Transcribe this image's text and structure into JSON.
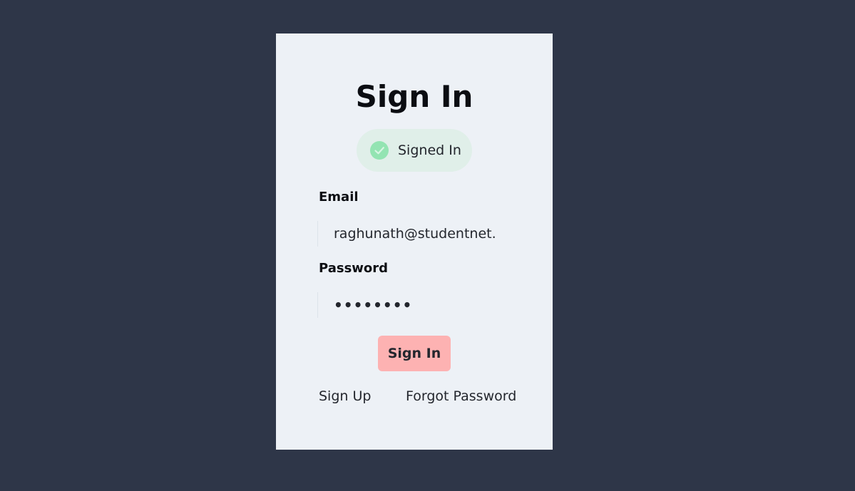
{
  "title": "Sign In",
  "status": {
    "icon": "check-circle-icon",
    "text": "Signed In",
    "color": "#93e4b2"
  },
  "form": {
    "email_label": "Email",
    "email_value": "raghunath@studentnet.com",
    "password_label": "Password",
    "password_value": "••••••••"
  },
  "submit_label": "Sign In",
  "links": {
    "sign_up": "Sign Up",
    "forgot_password": "Forgot Password"
  },
  "colors": {
    "background": "#2e3648",
    "card": "#edf1f6",
    "button": "#fdb2b2",
    "badge": "#e0efe9"
  }
}
